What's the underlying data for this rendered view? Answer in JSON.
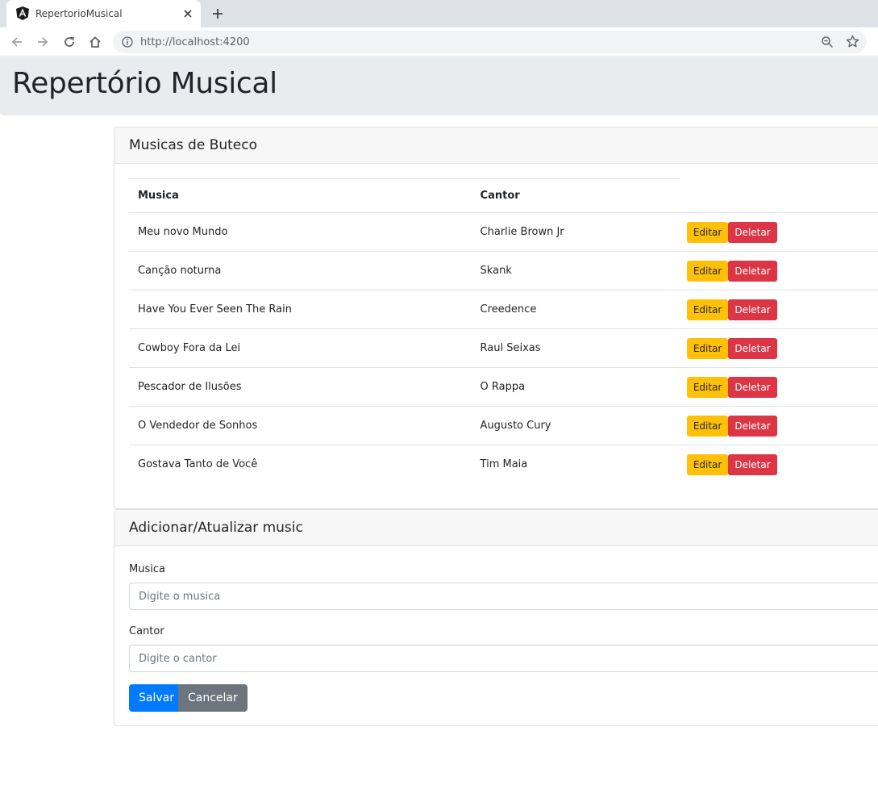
{
  "browser": {
    "tab_title": "RepertorioMusical",
    "url": "http://localhost:4200"
  },
  "page": {
    "title": "Repertório Musical"
  },
  "list_card": {
    "header": "Musicas de Buteco",
    "columns": [
      "Musica",
      "Cantor"
    ],
    "edit_label": "Editar",
    "delete_label": "Deletar",
    "rows": [
      {
        "musica": "Meu novo Mundo",
        "cantor": "Charlie Brown Jr"
      },
      {
        "musica": "Canção noturna",
        "cantor": "Skank"
      },
      {
        "musica": "Have You Ever Seen The Rain",
        "cantor": "Creedence"
      },
      {
        "musica": "Cowboy Fora da Lei",
        "cantor": "Raul Seixas"
      },
      {
        "musica": "Pescador de Ilusões",
        "cantor": "O Rappa"
      },
      {
        "musica": "O Vendedor de Sonhos",
        "cantor": "Augusto Cury"
      },
      {
        "musica": "Gostava Tanto de Você",
        "cantor": "Tim Maia"
      }
    ]
  },
  "form_card": {
    "header": "Adicionar/Atualizar music",
    "musica_label": "Musica",
    "musica_placeholder": "Digite o musica",
    "cantor_label": "Cantor",
    "cantor_placeholder": "Digite o cantor",
    "save_label": "Salvar",
    "cancel_label": "Cancelar"
  },
  "colors": {
    "warning": "#ffc107",
    "danger": "#dc3545",
    "primary": "#007bff",
    "secondary": "#6c757d"
  }
}
